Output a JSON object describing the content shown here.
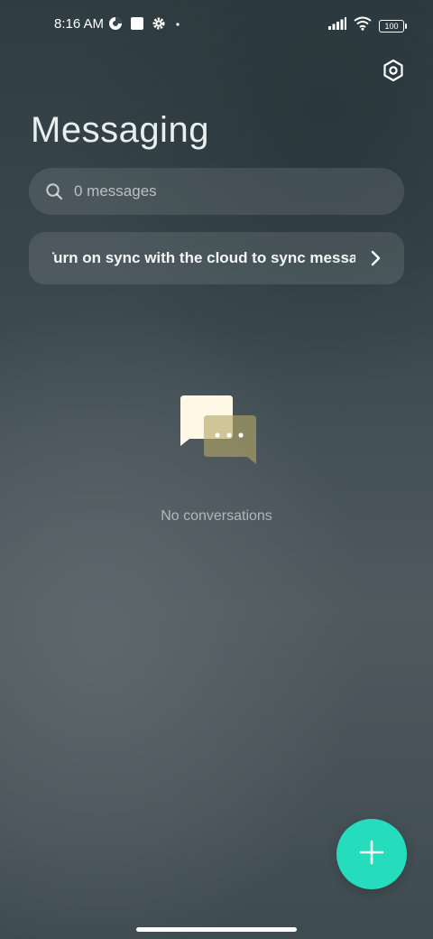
{
  "status_bar": {
    "time": "8:16 AM",
    "battery": "100"
  },
  "header": {
    "title": "Messaging"
  },
  "search": {
    "placeholder": "0 messages"
  },
  "sync_banner": {
    "text": "Turn on sync with the cloud to sync messages"
  },
  "empty_state": {
    "text": "No conversations"
  },
  "icons": {
    "status_left": [
      "data-saver-icon",
      "square-notification-icon",
      "settings-gear-icon",
      "dot-icon"
    ],
    "status_right": [
      "signal-icon",
      "wifi-icon",
      "battery-icon"
    ],
    "settings": "hexagon-settings-icon",
    "search": "search-icon",
    "sync_arrow": "chevron-right-icon",
    "fab": "plus-icon"
  },
  "colors": {
    "fab": "#25ddbc",
    "bubble_front": "#fff8e6",
    "bubble_back": "#b3a766"
  }
}
